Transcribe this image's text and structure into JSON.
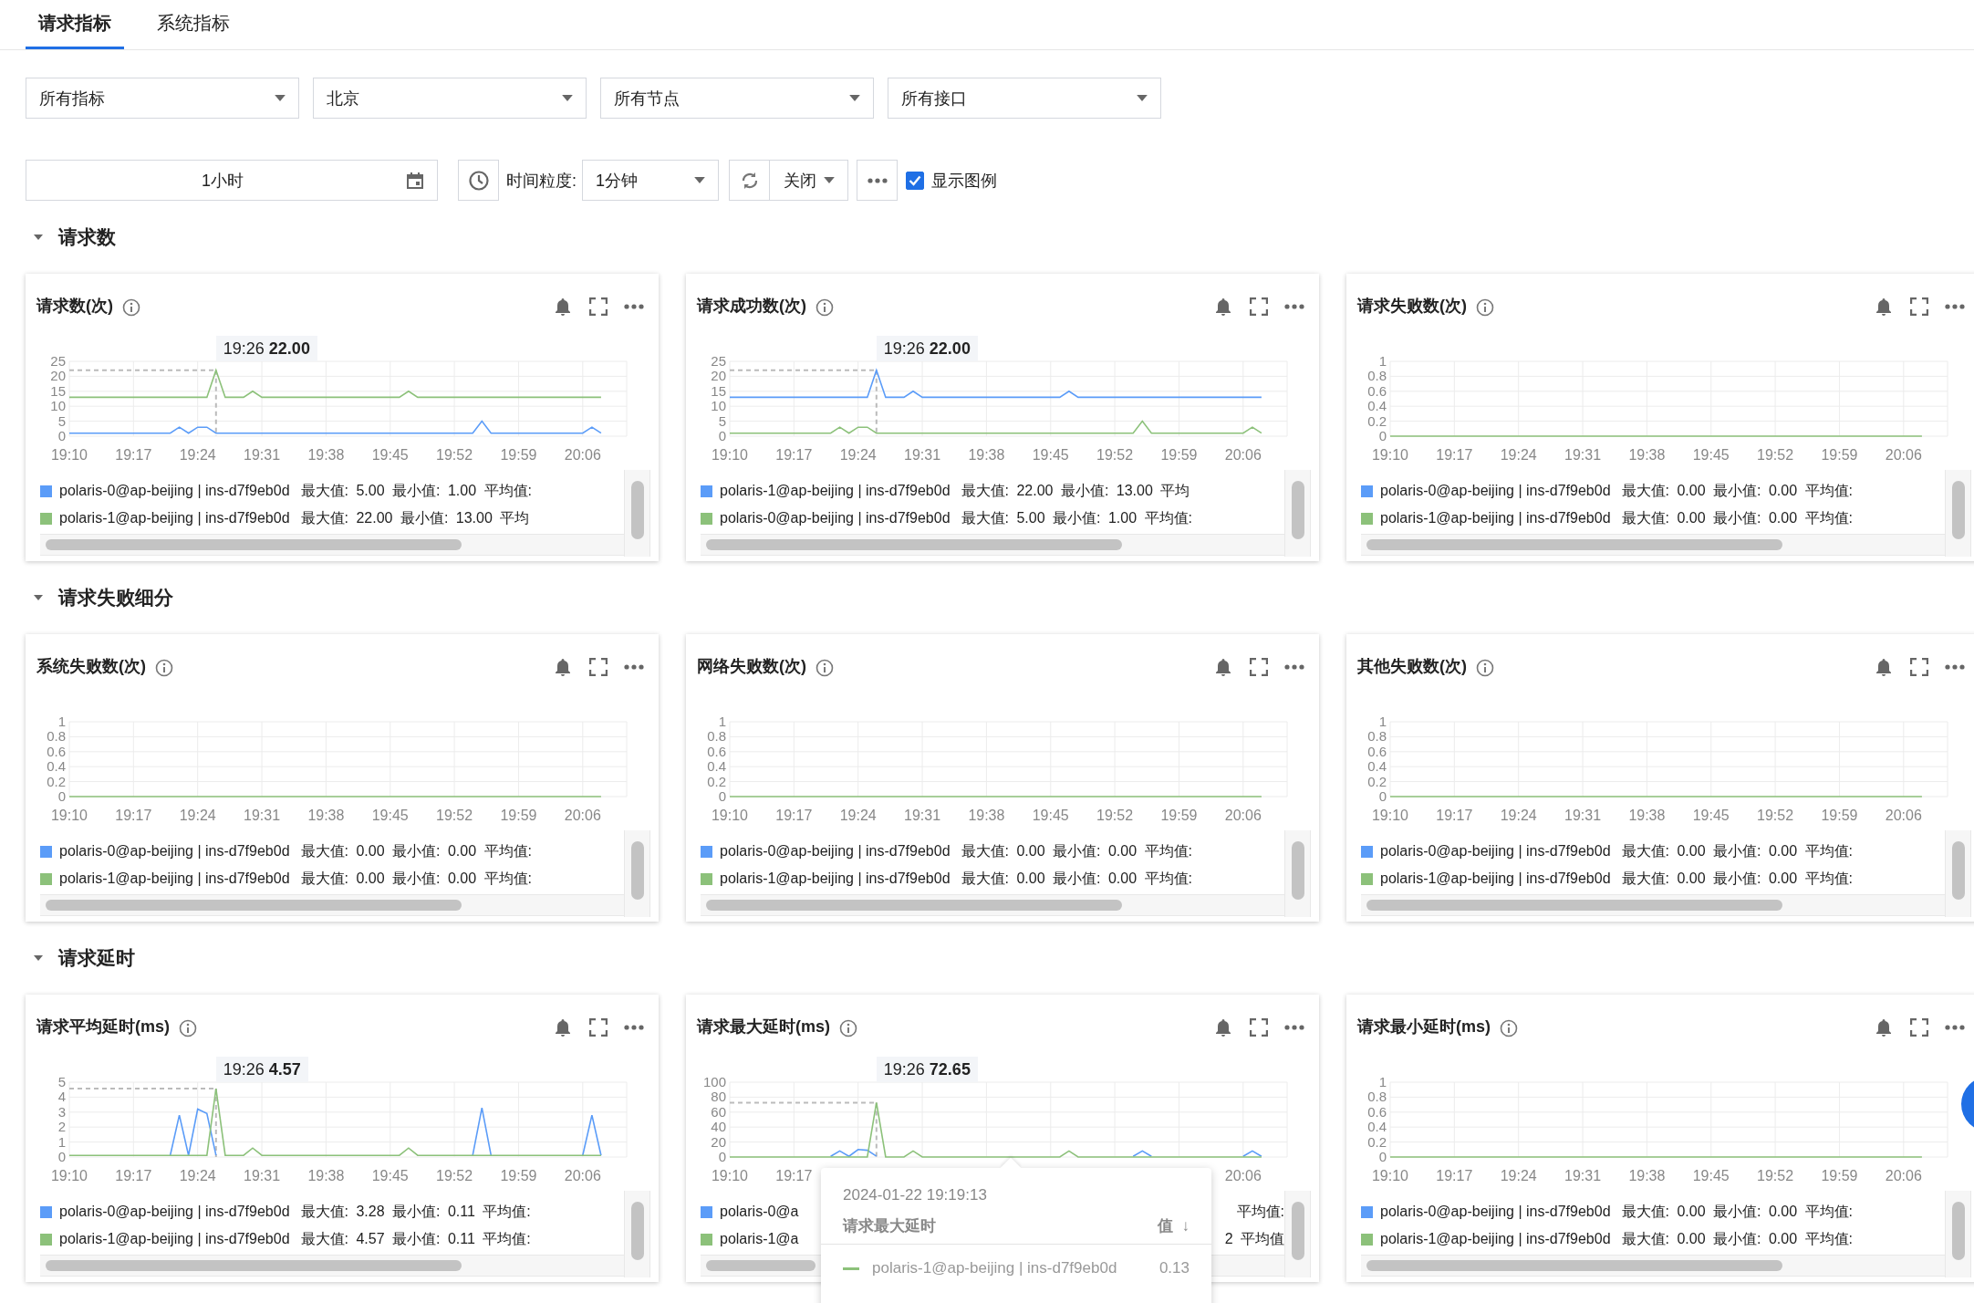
{
  "tabs": [
    {
      "label": "请求指标",
      "selected": true
    },
    {
      "label": "系统指标",
      "selected": false
    }
  ],
  "filters": [
    {
      "value": "所有指标"
    },
    {
      "value": "北京"
    },
    {
      "value": "所有节点"
    },
    {
      "value": "所有接口"
    }
  ],
  "toolbar": {
    "time_range": "1小时",
    "granularity_label": "时间粒度:",
    "granularity": "1分钟",
    "refresh": "关闭",
    "show_legend": {
      "label": "显示图例",
      "checked": true
    }
  },
  "sections": [
    {
      "title": "请求数",
      "expanded": true,
      "cards": [
        {
          "title": "请求数(次)",
          "legend": [
            {
              "name": "polaris-0@ap-beijing | ins-d7f9eb0d",
              "stats": "最大值: 5.00 最小值: 1.00 平均值:",
              "color": "#5b9cf8"
            },
            {
              "name": "polaris-1@ap-beijing | ins-d7f9eb0d",
              "stats": "最大值: 22.00 最小值: 13.00 平均",
              "color": "#8cc17a"
            }
          ],
          "chart_data": {
            "type": "line",
            "grid": true,
            "categories": [
              "19:10",
              null,
              null,
              null,
              null,
              null,
              null,
              "19:17",
              null,
              null,
              null,
              null,
              null,
              null,
              "19:24",
              null,
              null,
              null,
              null,
              null,
              null,
              "19:31",
              null,
              null,
              null,
              null,
              null,
              null,
              "19:38",
              null,
              null,
              null,
              null,
              null,
              null,
              "19:45",
              null,
              null,
              null,
              null,
              null,
              null,
              "19:52",
              null,
              null,
              null,
              null,
              null,
              null,
              "19:59",
              null,
              null,
              null,
              null,
              null,
              null,
              "20:06",
              null,
              null
            ],
            "ylim": [
              0,
              25
            ],
            "yticks": [
              0,
              5,
              10,
              15,
              20,
              25
            ],
            "series": [
              {
                "color": "#5b9cf8",
                "values": [
                  1,
                  1,
                  1,
                  1,
                  1,
                  1,
                  1,
                  1,
                  1,
                  1,
                  1,
                  1,
                  3,
                  1,
                  3,
                  3,
                  1,
                  1,
                  1,
                  1,
                  1,
                  1,
                  1,
                  1,
                  1,
                  1,
                  1,
                  1,
                  1,
                  1,
                  1,
                  1,
                  1,
                  1,
                  1,
                  1,
                  1,
                  1,
                  1,
                  1,
                  1,
                  1,
                  1,
                  1,
                  1,
                  5,
                  1,
                  1,
                  1,
                  1,
                  1,
                  1,
                  1,
                  1,
                  1,
                  1,
                  1,
                  3,
                  1
                ]
              },
              {
                "color": "#8cc17a",
                "values": [
                  13,
                  13,
                  13,
                  13,
                  13,
                  13,
                  13,
                  13,
                  13,
                  13,
                  13,
                  13,
                  13,
                  13,
                  13,
                  13,
                  22,
                  13,
                  13,
                  13,
                  15,
                  13,
                  13,
                  13,
                  13,
                  13,
                  13,
                  13,
                  13,
                  13,
                  13,
                  13,
                  13,
                  13,
                  13,
                  13,
                  13,
                  15,
                  13,
                  13,
                  13,
                  13,
                  13,
                  13,
                  13,
                  13,
                  13,
                  13,
                  13,
                  13,
                  13,
                  13,
                  13,
                  13,
                  13,
                  13,
                  13,
                  13,
                  13
                ]
              }
            ],
            "ref_lines": [
              {
                "axis": "y",
                "value": 22
              }
            ],
            "annotations": [
              "19:26 **22.00**"
            ]
          }
        },
        {
          "title": "请求成功数(次)",
          "legend": [
            {
              "name": "polaris-1@ap-beijing | ins-d7f9eb0d",
              "stats": "最大值: 22.00 最小值: 13.00 平均",
              "color": "#5b9cf8"
            },
            {
              "name": "polaris-0@ap-beijing | ins-d7f9eb0d",
              "stats": "最大值: 5.00 最小值: 1.00 平均值:",
              "color": "#8cc17a"
            }
          ],
          "chart_data": {
            "type": "line",
            "grid": true,
            "categories": [
              "19:10",
              null,
              null,
              null,
              null,
              null,
              null,
              "19:17",
              null,
              null,
              null,
              null,
              null,
              null,
              "19:24",
              null,
              null,
              null,
              null,
              null,
              null,
              "19:31",
              null,
              null,
              null,
              null,
              null,
              null,
              "19:38",
              null,
              null,
              null,
              null,
              null,
              null,
              "19:45",
              null,
              null,
              null,
              null,
              null,
              null,
              "19:52",
              null,
              null,
              null,
              null,
              null,
              null,
              "19:59",
              null,
              null,
              null,
              null,
              null,
              null,
              "20:06",
              null,
              null
            ],
            "ylim": [
              0,
              25
            ],
            "yticks": [
              0,
              5,
              10,
              15,
              20,
              25
            ],
            "series": [
              {
                "color": "#5b9cf8",
                "values": [
                  13,
                  13,
                  13,
                  13,
                  13,
                  13,
                  13,
                  13,
                  13,
                  13,
                  13,
                  13,
                  13,
                  13,
                  13,
                  13,
                  22,
                  13,
                  13,
                  13,
                  15,
                  13,
                  13,
                  13,
                  13,
                  13,
                  13,
                  13,
                  13,
                  13,
                  13,
                  13,
                  13,
                  13,
                  13,
                  13,
                  13,
                  15,
                  13,
                  13,
                  13,
                  13,
                  13,
                  13,
                  13,
                  13,
                  13,
                  13,
                  13,
                  13,
                  13,
                  13,
                  13,
                  13,
                  13,
                  13,
                  13,
                  13,
                  13
                ]
              },
              {
                "color": "#8cc17a",
                "values": [
                  1,
                  1,
                  1,
                  1,
                  1,
                  1,
                  1,
                  1,
                  1,
                  1,
                  1,
                  1,
                  3,
                  1,
                  3,
                  3,
                  1,
                  1,
                  1,
                  1,
                  1,
                  1,
                  1,
                  1,
                  1,
                  1,
                  1,
                  1,
                  1,
                  1,
                  1,
                  1,
                  1,
                  1,
                  1,
                  1,
                  1,
                  1,
                  1,
                  1,
                  1,
                  1,
                  1,
                  1,
                  1,
                  5,
                  1,
                  1,
                  1,
                  1,
                  1,
                  1,
                  1,
                  1,
                  1,
                  1,
                  1,
                  3,
                  1
                ]
              }
            ],
            "ref_lines": [
              {
                "axis": "y",
                "value": 22
              }
            ],
            "annotations": [
              "19:26 **22.00**"
            ]
          }
        },
        {
          "title": "请求失败数(次)",
          "legend": [
            {
              "name": "polaris-0@ap-beijing | ins-d7f9eb0d",
              "stats": "最大值: 0.00 最小值: 0.00 平均值:",
              "color": "#5b9cf8"
            },
            {
              "name": "polaris-1@ap-beijing | ins-d7f9eb0d",
              "stats": "最大值: 0.00 最小值: 0.00 平均值:",
              "color": "#8cc17a"
            }
          ],
          "chart_data": {
            "type": "line",
            "grid": true,
            "categories": [
              "19:10",
              null,
              null,
              null,
              null,
              null,
              null,
              "19:17",
              null,
              null,
              null,
              null,
              null,
              null,
              "19:24",
              null,
              null,
              null,
              null,
              null,
              null,
              "19:31",
              null,
              null,
              null,
              null,
              null,
              null,
              "19:38",
              null,
              null,
              null,
              null,
              null,
              null,
              "19:45",
              null,
              null,
              null,
              null,
              null,
              null,
              "19:52",
              null,
              null,
              null,
              null,
              null,
              null,
              "19:59",
              null,
              null,
              null,
              null,
              null,
              null,
              "20:06",
              null,
              null
            ],
            "ylim": [
              0,
              1
            ],
            "yticks": [
              0,
              0.2,
              0.4,
              0.6,
              0.8,
              1
            ],
            "series": [
              {
                "color": "#8cc17a",
                "values": [
                  0,
                  0,
                  0,
                  0,
                  0,
                  0,
                  0,
                  0,
                  0,
                  0,
                  0,
                  0,
                  0,
                  0,
                  0,
                  0,
                  0,
                  0,
                  0,
                  0,
                  0,
                  0,
                  0,
                  0,
                  0,
                  0,
                  0,
                  0,
                  0,
                  0,
                  0,
                  0,
                  0,
                  0,
                  0,
                  0,
                  0,
                  0,
                  0,
                  0,
                  0,
                  0,
                  0,
                  0,
                  0,
                  0,
                  0,
                  0,
                  0,
                  0,
                  0,
                  0,
                  0,
                  0,
                  0,
                  0,
                  0,
                  0,
                  0
                ]
              }
            ]
          }
        }
      ]
    },
    {
      "title": "请求失败细分",
      "expanded": true,
      "cards": [
        {
          "title": "系统失败数(次)",
          "legend": [
            {
              "name": "polaris-0@ap-beijing | ins-d7f9eb0d",
              "stats": "最大值: 0.00 最小值: 0.00 平均值:",
              "color": "#5b9cf8"
            },
            {
              "name": "polaris-1@ap-beijing | ins-d7f9eb0d",
              "stats": "最大值: 0.00 最小值: 0.00 平均值:",
              "color": "#8cc17a"
            }
          ],
          "chart_data": {
            "type": "line",
            "grid": true,
            "categories": [
              "19:10",
              null,
              null,
              null,
              null,
              null,
              null,
              "19:17",
              null,
              null,
              null,
              null,
              null,
              null,
              "19:24",
              null,
              null,
              null,
              null,
              null,
              null,
              "19:31",
              null,
              null,
              null,
              null,
              null,
              null,
              "19:38",
              null,
              null,
              null,
              null,
              null,
              null,
              "19:45",
              null,
              null,
              null,
              null,
              null,
              null,
              "19:52",
              null,
              null,
              null,
              null,
              null,
              null,
              "19:59",
              null,
              null,
              null,
              null,
              null,
              null,
              "20:06",
              null,
              null
            ],
            "ylim": [
              0,
              1
            ],
            "yticks": [
              0,
              0.2,
              0.4,
              0.6,
              0.8,
              1
            ],
            "series": [
              {
                "color": "#8cc17a",
                "values": [
                  0,
                  0,
                  0,
                  0,
                  0,
                  0,
                  0,
                  0,
                  0,
                  0,
                  0,
                  0,
                  0,
                  0,
                  0,
                  0,
                  0,
                  0,
                  0,
                  0,
                  0,
                  0,
                  0,
                  0,
                  0,
                  0,
                  0,
                  0,
                  0,
                  0,
                  0,
                  0,
                  0,
                  0,
                  0,
                  0,
                  0,
                  0,
                  0,
                  0,
                  0,
                  0,
                  0,
                  0,
                  0,
                  0,
                  0,
                  0,
                  0,
                  0,
                  0,
                  0,
                  0,
                  0,
                  0,
                  0,
                  0,
                  0,
                  0
                ]
              }
            ]
          }
        },
        {
          "title": "网络失败数(次)",
          "legend": [
            {
              "name": "polaris-0@ap-beijing | ins-d7f9eb0d",
              "stats": "最大值: 0.00 最小值: 0.00 平均值:",
              "color": "#5b9cf8"
            },
            {
              "name": "polaris-1@ap-beijing | ins-d7f9eb0d",
              "stats": "最大值: 0.00 最小值: 0.00 平均值:",
              "color": "#8cc17a"
            }
          ],
          "chart_data": {
            "type": "line",
            "grid": true,
            "categories": [
              "19:10",
              null,
              null,
              null,
              null,
              null,
              null,
              "19:17",
              null,
              null,
              null,
              null,
              null,
              null,
              "19:24",
              null,
              null,
              null,
              null,
              null,
              null,
              "19:31",
              null,
              null,
              null,
              null,
              null,
              null,
              "19:38",
              null,
              null,
              null,
              null,
              null,
              null,
              "19:45",
              null,
              null,
              null,
              null,
              null,
              null,
              "19:52",
              null,
              null,
              null,
              null,
              null,
              null,
              "19:59",
              null,
              null,
              null,
              null,
              null,
              null,
              "20:06",
              null,
              null
            ],
            "ylim": [
              0,
              1
            ],
            "yticks": [
              0,
              0.2,
              0.4,
              0.6,
              0.8,
              1
            ],
            "series": [
              {
                "color": "#8cc17a",
                "values": [
                  0,
                  0,
                  0,
                  0,
                  0,
                  0,
                  0,
                  0,
                  0,
                  0,
                  0,
                  0,
                  0,
                  0,
                  0,
                  0,
                  0,
                  0,
                  0,
                  0,
                  0,
                  0,
                  0,
                  0,
                  0,
                  0,
                  0,
                  0,
                  0,
                  0,
                  0,
                  0,
                  0,
                  0,
                  0,
                  0,
                  0,
                  0,
                  0,
                  0,
                  0,
                  0,
                  0,
                  0,
                  0,
                  0,
                  0,
                  0,
                  0,
                  0,
                  0,
                  0,
                  0,
                  0,
                  0,
                  0,
                  0,
                  0,
                  0
                ]
              }
            ]
          }
        },
        {
          "title": "其他失败数(次)",
          "legend": [
            {
              "name": "polaris-0@ap-beijing | ins-d7f9eb0d",
              "stats": "最大值: 0.00 最小值: 0.00 平均值:",
              "color": "#5b9cf8"
            },
            {
              "name": "polaris-1@ap-beijing | ins-d7f9eb0d",
              "stats": "最大值: 0.00 最小值: 0.00 平均值:",
              "color": "#8cc17a"
            }
          ],
          "chart_data": {
            "type": "line",
            "grid": true,
            "categories": [
              "19:10",
              null,
              null,
              null,
              null,
              null,
              null,
              "19:17",
              null,
              null,
              null,
              null,
              null,
              null,
              "19:24",
              null,
              null,
              null,
              null,
              null,
              null,
              "19:31",
              null,
              null,
              null,
              null,
              null,
              null,
              "19:38",
              null,
              null,
              null,
              null,
              null,
              null,
              "19:45",
              null,
              null,
              null,
              null,
              null,
              null,
              "19:52",
              null,
              null,
              null,
              null,
              null,
              null,
              "19:59",
              null,
              null,
              null,
              null,
              null,
              null,
              "20:06",
              null,
              null
            ],
            "ylim": [
              0,
              1
            ],
            "yticks": [
              0,
              0.2,
              0.4,
              0.6,
              0.8,
              1
            ],
            "series": [
              {
                "color": "#8cc17a",
                "values": [
                  0,
                  0,
                  0,
                  0,
                  0,
                  0,
                  0,
                  0,
                  0,
                  0,
                  0,
                  0,
                  0,
                  0,
                  0,
                  0,
                  0,
                  0,
                  0,
                  0,
                  0,
                  0,
                  0,
                  0,
                  0,
                  0,
                  0,
                  0,
                  0,
                  0,
                  0,
                  0,
                  0,
                  0,
                  0,
                  0,
                  0,
                  0,
                  0,
                  0,
                  0,
                  0,
                  0,
                  0,
                  0,
                  0,
                  0,
                  0,
                  0,
                  0,
                  0,
                  0,
                  0,
                  0,
                  0,
                  0,
                  0,
                  0,
                  0
                ]
              }
            ]
          }
        }
      ]
    },
    {
      "title": "请求延时",
      "expanded": true,
      "cards": [
        {
          "title": "请求平均延时(ms)",
          "legend": [
            {
              "name": "polaris-0@ap-beijing | ins-d7f9eb0d",
              "stats": "最大值: 3.28 最小值: 0.11 平均值:",
              "color": "#5b9cf8"
            },
            {
              "name": "polaris-1@ap-beijing | ins-d7f9eb0d",
              "stats": "最大值: 4.57 最小值: 0.11 平均值:",
              "color": "#8cc17a"
            }
          ],
          "chart_data": {
            "type": "line",
            "grid": true,
            "categories": [
              "19:10",
              null,
              null,
              null,
              null,
              null,
              null,
              "19:17",
              null,
              null,
              null,
              null,
              null,
              null,
              "19:24",
              null,
              null,
              null,
              null,
              null,
              null,
              "19:31",
              null,
              null,
              null,
              null,
              null,
              null,
              "19:38",
              null,
              null,
              null,
              null,
              null,
              null,
              "19:45",
              null,
              null,
              null,
              null,
              null,
              null,
              "19:52",
              null,
              null,
              null,
              null,
              null,
              null,
              "19:59",
              null,
              null,
              null,
              null,
              null,
              null,
              "20:06",
              null,
              null
            ],
            "ylim": [
              0,
              5
            ],
            "yticks": [
              0,
              1,
              2,
              3,
              4,
              5
            ],
            "series": [
              {
                "color": "#5b9cf8",
                "values": [
                  null,
                  null,
                  null,
                  null,
                  null,
                  null,
                  null,
                  null,
                  null,
                  null,
                  null,
                  0.11,
                  2.8,
                  0.11,
                  3.2,
                  2.9,
                  0.11,
                  null,
                  null,
                  null,
                  null,
                  null,
                  null,
                  null,
                  null,
                  null,
                  null,
                  null,
                  null,
                  null,
                  null,
                  null,
                  null,
                  null,
                  null,
                  null,
                  null,
                  null,
                  null,
                  null,
                  null,
                  null,
                  null,
                  null,
                  0.11,
                  3.28,
                  0.11,
                  null,
                  null,
                  null,
                  null,
                  null,
                  null,
                  null,
                  null,
                  null,
                  0.11,
                  2.8,
                  0.11
                ]
              },
              {
                "color": "#8cc17a",
                "values": [
                  0.11,
                  0.11,
                  0.11,
                  0.11,
                  0.11,
                  0.11,
                  0.11,
                  0.11,
                  0.11,
                  0.11,
                  0.11,
                  0.11,
                  0.11,
                  0.11,
                  0.11,
                  0.11,
                  4.57,
                  0.11,
                  0.11,
                  0.11,
                  0.6,
                  0.11,
                  0.11,
                  0.11,
                  0.11,
                  0.11,
                  0.11,
                  0.11,
                  0.11,
                  0.11,
                  0.11,
                  0.11,
                  0.11,
                  0.11,
                  0.11,
                  0.11,
                  0.11,
                  0.6,
                  0.11,
                  0.11,
                  0.11,
                  0.11,
                  0.11,
                  0.11,
                  0.11,
                  0.11,
                  0.11,
                  0.11,
                  0.11,
                  0.11,
                  0.11,
                  0.11,
                  0.11,
                  0.11,
                  0.11,
                  0.11,
                  0.11,
                  0.11,
                  0.11
                ]
              }
            ],
            "ref_lines": [
              {
                "axis": "y",
                "value": 4.57
              }
            ],
            "annotations": [
              "19:26 **4.57**"
            ]
          }
        },
        {
          "title": "请求最大延时(ms)",
          "legend": [
            {
              "name": "polaris-0@a",
              "stats": "平均值:",
              "color": "#5b9cf8"
            },
            {
              "name": "polaris-1@a",
              "stats": "2 平均值",
              "color": "#8cc17a"
            }
          ],
          "chart_data": {
            "type": "line",
            "grid": true,
            "categories": [
              "19:10",
              null,
              null,
              null,
              null,
              null,
              null,
              "19:17",
              null,
              null,
              null,
              null,
              null,
              null,
              null,
              null,
              null,
              null,
              null,
              null,
              null,
              null,
              null,
              null,
              null,
              null,
              null,
              null,
              null,
              null,
              null,
              null,
              null,
              null,
              null,
              null,
              null,
              null,
              null,
              null,
              null,
              null,
              null,
              null,
              null,
              null,
              null,
              null,
              null,
              null,
              null,
              null,
              null,
              null,
              null,
              null,
              "20:06",
              null,
              null
            ],
            "ylim": [
              0,
              100
            ],
            "yticks": [
              0,
              20,
              40,
              60,
              80,
              100
            ],
            "series": [
              {
                "color": "#5b9cf8",
                "values": [
                  null,
                  null,
                  null,
                  null,
                  null,
                  null,
                  null,
                  null,
                  null,
                  null,
                  null,
                  1,
                  8,
                  1,
                  10,
                  9,
                  1,
                  null,
                  null,
                  null,
                  null,
                  null,
                  null,
                  null,
                  null,
                  null,
                  null,
                  null,
                  null,
                  null,
                  null,
                  null,
                  null,
                  null,
                  null,
                  null,
                  null,
                  null,
                  null,
                  null,
                  null,
                  null,
                  null,
                  null,
                  1,
                  8,
                  1,
                  null,
                  null,
                  null,
                  null,
                  null,
                  null,
                  null,
                  null,
                  null,
                  1,
                  8,
                  1
                ]
              },
              {
                "color": "#8cc17a",
                "values": [
                  0,
                  0,
                  0,
                  0,
                  0,
                  0,
                  0,
                  0,
                  0,
                  0,
                  0,
                  0,
                  0,
                  0,
                  0,
                  0,
                  72.65,
                  0,
                  0,
                  0,
                  8,
                  0,
                  0,
                  0,
                  0,
                  0,
                  0,
                  0,
                  0,
                  0,
                  0,
                  0,
                  0,
                  0,
                  0,
                  0,
                  0,
                  8,
                  0,
                  0,
                  0,
                  0,
                  0,
                  0,
                  0,
                  0,
                  0,
                  0,
                  0,
                  0,
                  0,
                  0,
                  0,
                  0,
                  0,
                  0,
                  0,
                  0,
                  0
                ]
              }
            ],
            "ref_lines": [
              {
                "axis": "y",
                "value": 72.65
              }
            ],
            "annotations": [
              "19:26 **72.65**"
            ]
          },
          "popover": {
            "time": "2024-01-22 19:19:13",
            "title": "请求最大延时",
            "value_header": "值",
            "sort": "↓",
            "rows": [
              {
                "name": "polaris-1@ap-beijing | ins-d7f9eb0d",
                "value": "0.13",
                "color": "#8cc17a"
              }
            ]
          }
        },
        {
          "title": "请求最小延时(ms)",
          "legend": [
            {
              "name": "polaris-0@ap-beijing | ins-d7f9eb0d",
              "stats": "最大值: 0.00 最小值: 0.00 平均值:",
              "color": "#5b9cf8"
            },
            {
              "name": "polaris-1@ap-beijing | ins-d7f9eb0d",
              "stats": "最大值: 0.00 最小值: 0.00 平均值:",
              "color": "#8cc17a"
            }
          ],
          "chart_data": {
            "type": "line",
            "grid": true,
            "categories": [
              "19:10",
              null,
              null,
              null,
              null,
              null,
              null,
              "19:17",
              null,
              null,
              null,
              null,
              null,
              null,
              "19:24",
              null,
              null,
              null,
              null,
              null,
              null,
              "19:31",
              null,
              null,
              null,
              null,
              null,
              null,
              "19:38",
              null,
              null,
              null,
              null,
              null,
              null,
              "19:45",
              null,
              null,
              null,
              null,
              null,
              null,
              "19:52",
              null,
              null,
              null,
              null,
              null,
              null,
              "19:59",
              null,
              null,
              null,
              null,
              null,
              null,
              "20:06",
              null,
              null
            ],
            "ylim": [
              0,
              1
            ],
            "yticks": [
              0,
              0.2,
              0.4,
              0.6,
              0.8,
              1
            ],
            "series": [
              {
                "color": "#8cc17a",
                "values": [
                  0,
                  0,
                  0,
                  0,
                  0,
                  0,
                  0,
                  0,
                  0,
                  0,
                  0,
                  0,
                  0,
                  0,
                  0,
                  0,
                  0,
                  0,
                  0,
                  0,
                  0,
                  0,
                  0,
                  0,
                  0,
                  0,
                  0,
                  0,
                  0,
                  0,
                  0,
                  0,
                  0,
                  0,
                  0,
                  0,
                  0,
                  0,
                  0,
                  0,
                  0,
                  0,
                  0,
                  0,
                  0,
                  0,
                  0,
                  0,
                  0,
                  0,
                  0,
                  0,
                  0,
                  0,
                  0,
                  0,
                  0,
                  0,
                  0
                ]
              }
            ]
          }
        }
      ]
    }
  ]
}
